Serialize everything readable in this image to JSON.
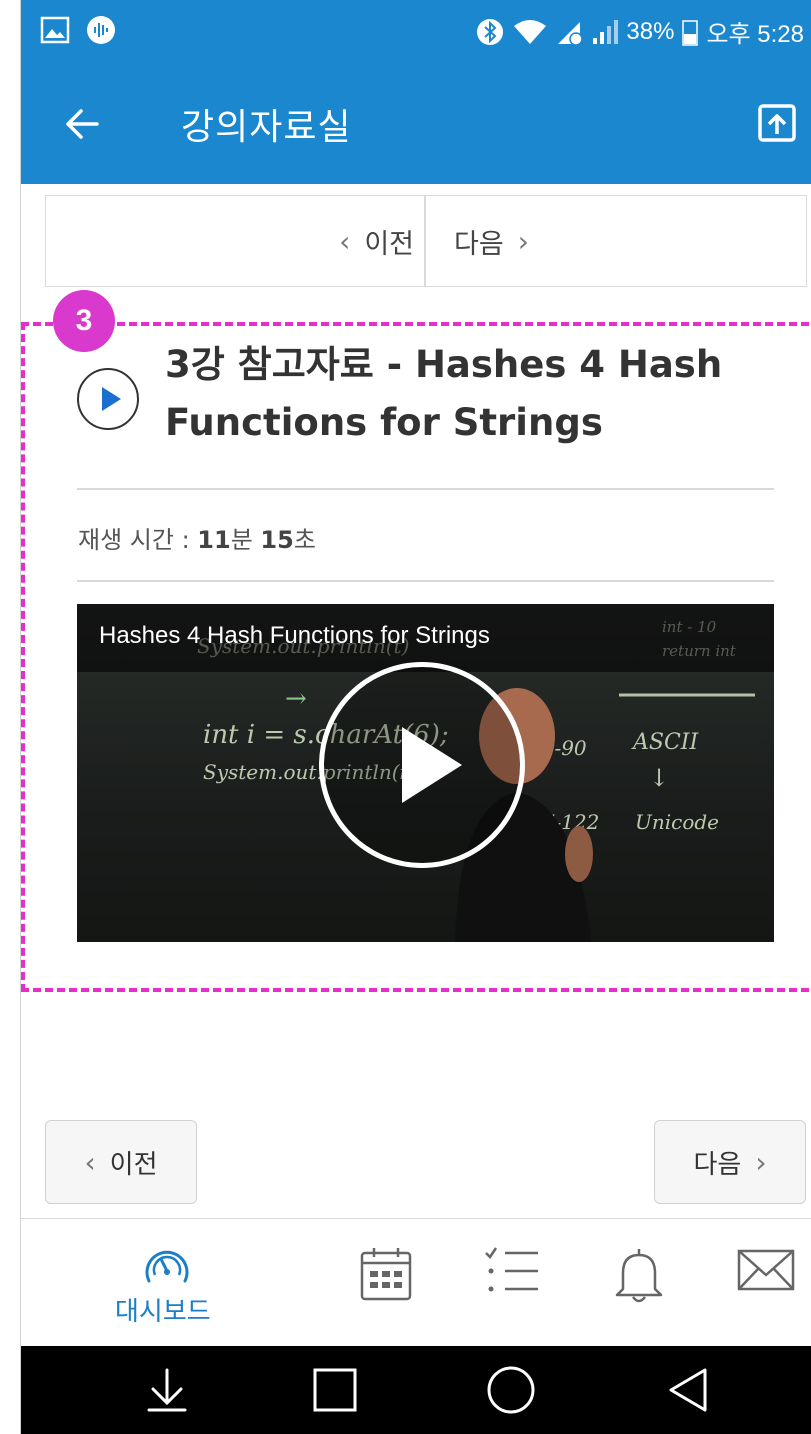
{
  "status_bar": {
    "battery": "38%",
    "time": "오후 5:28",
    "icons": [
      "gallery-icon",
      "audio-app-icon",
      "bluetooth-icon",
      "wifi-icon",
      "data-off-icon",
      "signal-icon",
      "battery-icon"
    ]
  },
  "appbar": {
    "title": "강의자료실",
    "back_icon": "arrow-left-icon",
    "action_icon": "upload-icon"
  },
  "pager_top": {
    "prev_label": "이전",
    "next_label": "다음"
  },
  "annotation": {
    "badge": "3",
    "color": "#e62fc8"
  },
  "lecture": {
    "title": "3강 참고자료 - Hashes 4 Hash Functions for Strings",
    "duration_label": "재생 시간 : ",
    "duration_minutes": "11",
    "minutes_unit": "분 ",
    "duration_seconds": "15",
    "seconds_unit": "초",
    "video_title": "Hashes 4 Hash Functions for Strings"
  },
  "pager_bottom": {
    "prev_label": "이전",
    "next_label": "다음"
  },
  "tabbar": {
    "items": [
      {
        "label": "대시보드",
        "icon": "dashboard-icon",
        "active": true
      },
      {
        "label": "",
        "icon": "calendar-icon",
        "active": false
      },
      {
        "label": "",
        "icon": "todo-list-icon",
        "active": false
      },
      {
        "label": "",
        "icon": "bell-icon",
        "active": false
      },
      {
        "label": "",
        "icon": "mail-icon",
        "active": false
      }
    ]
  },
  "colors": {
    "primary": "#1a87cf",
    "active_tab": "#1a7fc6",
    "highlight": "#e62fc8",
    "badge": "#d93acd"
  }
}
